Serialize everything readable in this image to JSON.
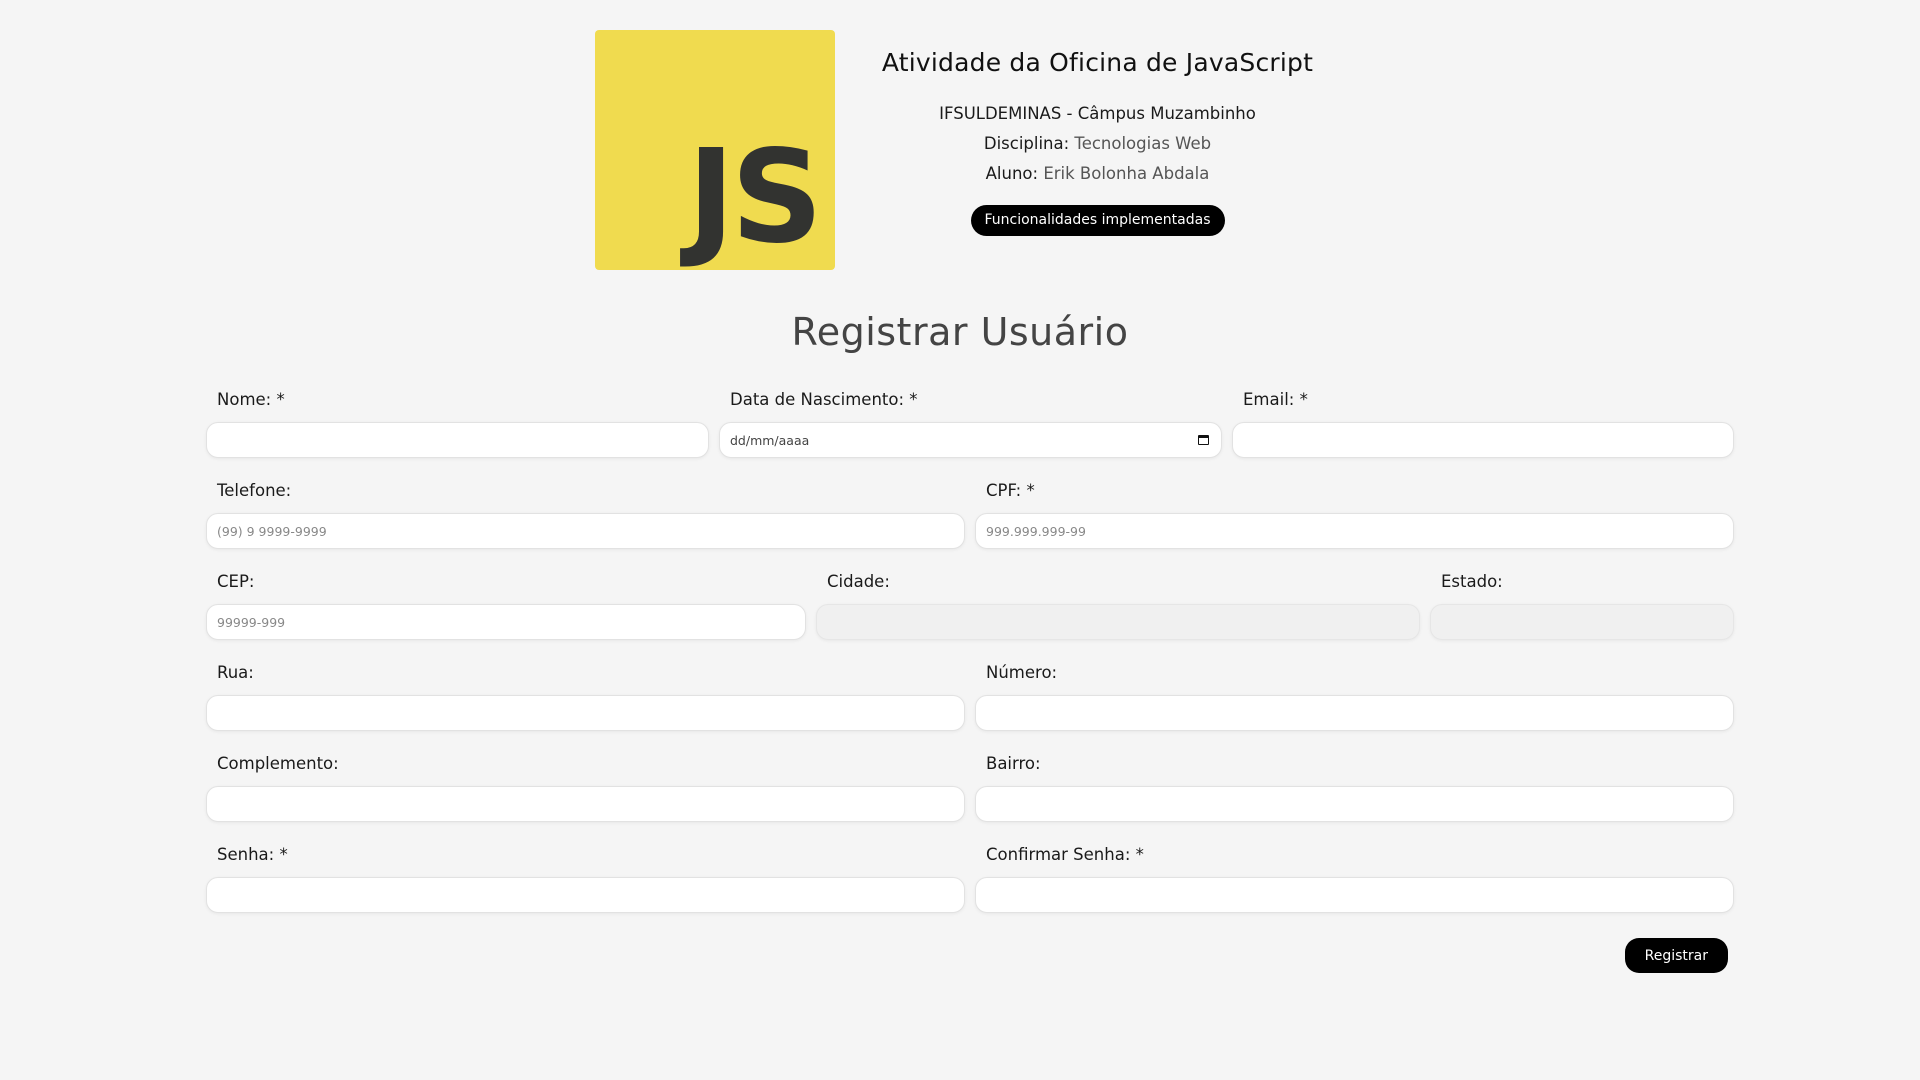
{
  "header": {
    "logo_text": "JS",
    "title": "Atividade da Oficina de JavaScript",
    "institution": "IFSULDEMINAS - Câmpus Muzambinho",
    "discipline_label": "Disciplina:",
    "discipline_value": "Tecnologias Web",
    "student_label": "Aluno:",
    "student_value": "Erik Bolonha Abdala",
    "features_button": "Funcionalidades implementadas"
  },
  "form": {
    "title": "Registrar Usuário",
    "fields": {
      "nome": {
        "label": "Nome: *",
        "placeholder": ""
      },
      "nascimento": {
        "label": "Data de Nascimento: *",
        "placeholder": "dd/mm/aaaa"
      },
      "email": {
        "label": "Email: *",
        "placeholder": ""
      },
      "telefone": {
        "label": "Telefone:",
        "placeholder": "(99) 9 9999-9999"
      },
      "cpf": {
        "label": "CPF: *",
        "placeholder": "999.999.999-99"
      },
      "cep": {
        "label": "CEP:",
        "placeholder": "99999-999"
      },
      "cidade": {
        "label": "Cidade:",
        "placeholder": ""
      },
      "estado": {
        "label": "Estado:",
        "placeholder": ""
      },
      "rua": {
        "label": "Rua:",
        "placeholder": ""
      },
      "numero": {
        "label": "Número:",
        "placeholder": ""
      },
      "complemento": {
        "label": "Complemento:",
        "placeholder": ""
      },
      "bairro": {
        "label": "Bairro:",
        "placeholder": ""
      },
      "senha": {
        "label": "Senha: *",
        "placeholder": ""
      },
      "confirmar_senha": {
        "label": "Confirmar Senha: *",
        "placeholder": ""
      }
    },
    "submit_label": "Registrar"
  },
  "colors": {
    "background": "#f5f5f5",
    "js_yellow": "#f0db4f",
    "js_text": "#323330",
    "button_bg": "#000000",
    "button_text": "#ffffff"
  }
}
